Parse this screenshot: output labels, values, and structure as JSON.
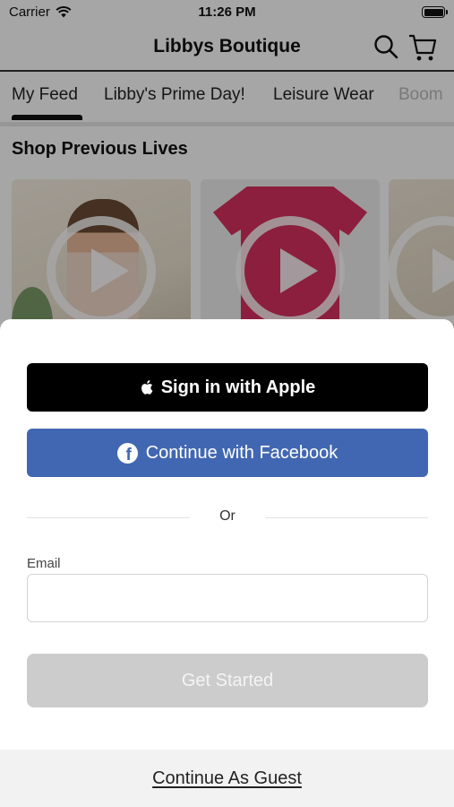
{
  "status_bar": {
    "carrier": "Carrier",
    "time": "11:26 PM"
  },
  "header": {
    "title": "Libbys Boutique",
    "search_icon": "search-icon",
    "cart_icon": "cart-icon"
  },
  "tabs": [
    {
      "label": "My Feed",
      "selected": true
    },
    {
      "label": "Libby's Prime Day!",
      "selected": false
    },
    {
      "label": "Leisure Wear",
      "selected": false
    },
    {
      "label": "Boom",
      "selected": false
    }
  ],
  "feed": {
    "section_title": "Shop Previous Lives"
  },
  "sheet": {
    "apple_label": "Sign in with Apple",
    "facebook_label": "Continue with Facebook",
    "or_label": "Or",
    "email_label": "Email",
    "email_value": "",
    "get_started_label": "Get Started",
    "guest_label": "Continue As Guest"
  },
  "colors": {
    "facebook": "#4267b2",
    "apple": "#000000",
    "disabled_button": "#cccccc"
  }
}
